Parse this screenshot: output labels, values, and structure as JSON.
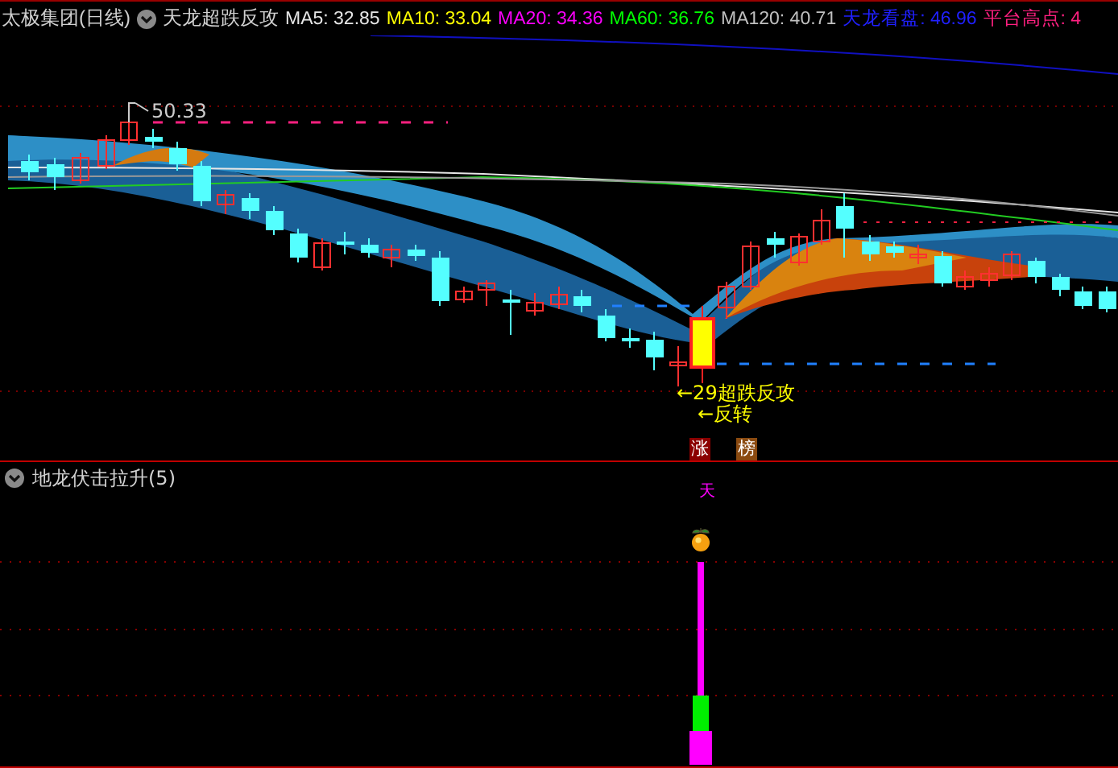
{
  "header": {
    "stock": "太极集团(日线)",
    "indicator": "天龙超跌反攻",
    "readings": [
      {
        "label": "MA5: 32.85",
        "color": "#e6e6e6"
      },
      {
        "label": "MA10: 33.04",
        "color": "#ffff00"
      },
      {
        "label": "MA20: 34.36",
        "color": "#ff00ff"
      },
      {
        "label": "MA60: 36.76",
        "color": "#00ff00"
      },
      {
        "label": "MA120: 40.71",
        "color": "#c0c0c0"
      },
      {
        "label": "天龙看盘: 46.96",
        "color": "#2020ff"
      },
      {
        "label": "平台高点: 4",
        "color": "#ff2080"
      }
    ]
  },
  "chart": {
    "high_label": "50.33",
    "signal_labels": [
      "←29超跌反攻",
      "←反转"
    ],
    "badges": [
      "涨",
      "榜"
    ]
  },
  "oscillator": {
    "title": "地龙伏击拉升(5)",
    "marker": "天"
  }
}
